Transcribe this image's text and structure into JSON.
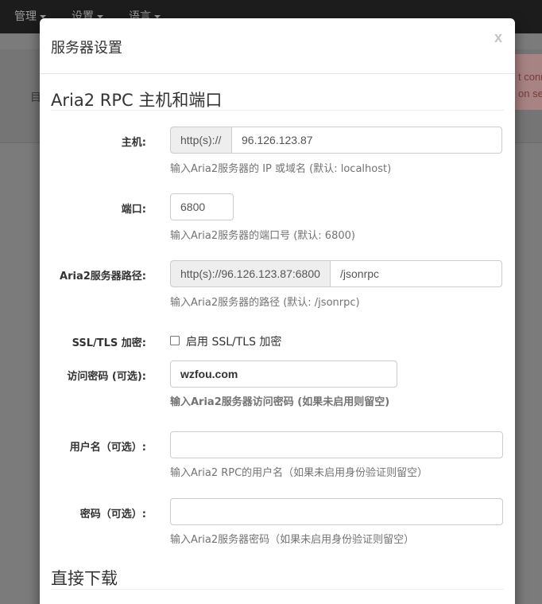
{
  "navbar": {
    "items": [
      {
        "label": "管理"
      },
      {
        "label": "设置"
      },
      {
        "label": "语言"
      }
    ]
  },
  "background": {
    "alert_lines": [
      "t conn",
      "on set"
    ],
    "left_char": "目"
  },
  "modal": {
    "title": "服务器设置",
    "close_label": "x",
    "section_rpc_title": "Aria2 RPC 主机和端口",
    "section_download_title": "直接下载",
    "host": {
      "label": "主机:",
      "addon": "http(s)://",
      "value": "96.126.123.87",
      "help": "输入Aria2服务器的 IP 或域名 (默认: localhost)"
    },
    "port": {
      "label": "端口:",
      "value": "6800",
      "help": "输入Aria2服务器的端口号 (默认: 6800)"
    },
    "path": {
      "label": "Aria2服务器路径:",
      "addon": "http(s)://96.126.123.87:6800",
      "value": "/jsonrpc",
      "help": "输入Aria2服务器的路径 (默认: /jsonrpc)"
    },
    "ssl": {
      "label": "SSL/TLS 加密:",
      "checkbox_label": "启用 SSL/TLS 加密",
      "checked": false
    },
    "secret": {
      "label": "访问密码 (可选):",
      "value": "wzfou.com",
      "help": "输入Aria2服务器访问密码 (如果未启用则留空)"
    },
    "username": {
      "label": "用户名（可选）:",
      "value": "",
      "help": "输入Aria2 RPC的用户名（如果未启用身份验证则留空）"
    },
    "password": {
      "label": "密码（可选）:",
      "value": "",
      "help": "输入Aria2服务器密码（如果未启用身份验证则留空）"
    }
  }
}
